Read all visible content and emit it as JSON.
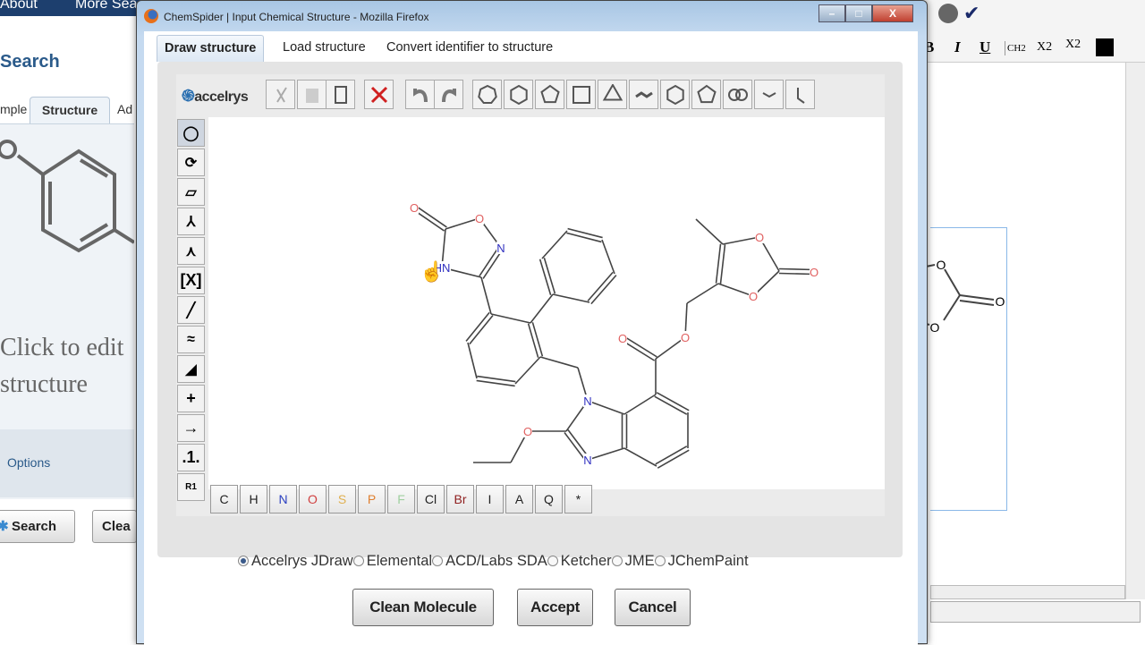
{
  "background_page": {
    "nav": [
      "About",
      "More Sea"
    ],
    "title": "Search",
    "tabs": [
      "mple",
      "Structure",
      "Ad"
    ],
    "edit_prompt": [
      "Click to edit",
      "structure"
    ],
    "options_label": "Options",
    "search_button": "Search",
    "clear_button": "Clea"
  },
  "right_editor": {
    "format_buttons": [
      "B",
      "I",
      "U",
      "CH2",
      "X2",
      "X2"
    ],
    "color_swatch": "#000000",
    "molecule_labels": [
      "O",
      "O",
      "O"
    ]
  },
  "dialog": {
    "title": "ChemSpider | Input Chemical Structure - Mozilla Firefox",
    "window_buttons": [
      "–",
      "□",
      "X"
    ],
    "tabs": [
      "Draw structure",
      "Load structure",
      "Convert identifier to structure"
    ],
    "logo": "accelrys",
    "toolbar": [
      "cut",
      "copy",
      "paste",
      "clear",
      "undo",
      "redo",
      "cycloheptane",
      "cyclohexane",
      "cyclopentane",
      "cyclobutane",
      "cyclopropane",
      "chain",
      "benzene",
      "cyclopentadiene",
      "naphthalene",
      "bond-chain",
      "single-bond"
    ],
    "left_tools": [
      "lasso",
      "rotate",
      "eraser",
      "atom-map",
      "stereo",
      "bracket",
      "single-bond",
      "wavy-bond",
      "wedge-bond",
      "plus",
      "arrow",
      "charge",
      "r-group"
    ],
    "left_tool_text": {
      "plus": "+",
      "arrow": "→",
      "charge": ".1.",
      "bracket": "[X]"
    },
    "elements": [
      {
        "label": "C",
        "color": "#222222"
      },
      {
        "label": "H",
        "color": "#222222"
      },
      {
        "label": "N",
        "color": "#2a3fc0"
      },
      {
        "label": "O",
        "color": "#d04040"
      },
      {
        "label": "S",
        "color": "#e0b050"
      },
      {
        "label": "P",
        "color": "#e08030"
      },
      {
        "label": "F",
        "color": "#a0d0a0"
      },
      {
        "label": "Cl",
        "color": "#222222"
      },
      {
        "label": "Br",
        "color": "#902020"
      },
      {
        "label": "I",
        "color": "#222222"
      },
      {
        "label": "A",
        "color": "#222222"
      },
      {
        "label": "Q",
        "color": "#222222"
      },
      {
        "label": "*",
        "color": "#222222"
      }
    ],
    "editors": [
      {
        "label": "Accelrys JDraw",
        "selected": true
      },
      {
        "label": "Elemental",
        "selected": false
      },
      {
        "label": "ACD/Labs SDA",
        "selected": false
      },
      {
        "label": "Ketcher",
        "selected": false
      },
      {
        "label": "JME",
        "selected": false
      },
      {
        "label": "JChemPaint",
        "selected": false
      }
    ],
    "molecule_atom_labels": [
      "O",
      "O",
      "N",
      "HN",
      "N",
      "N",
      "O",
      "O",
      "O",
      "O",
      "O",
      "O"
    ],
    "buttons": {
      "clean": "Clean Molecule",
      "accept": "Accept",
      "cancel": "Cancel"
    }
  },
  "colors": {
    "oxygen": "#e06060",
    "nitrogen": "#3030c0",
    "bond": "#444444",
    "accent": "#2a6fb0"
  }
}
